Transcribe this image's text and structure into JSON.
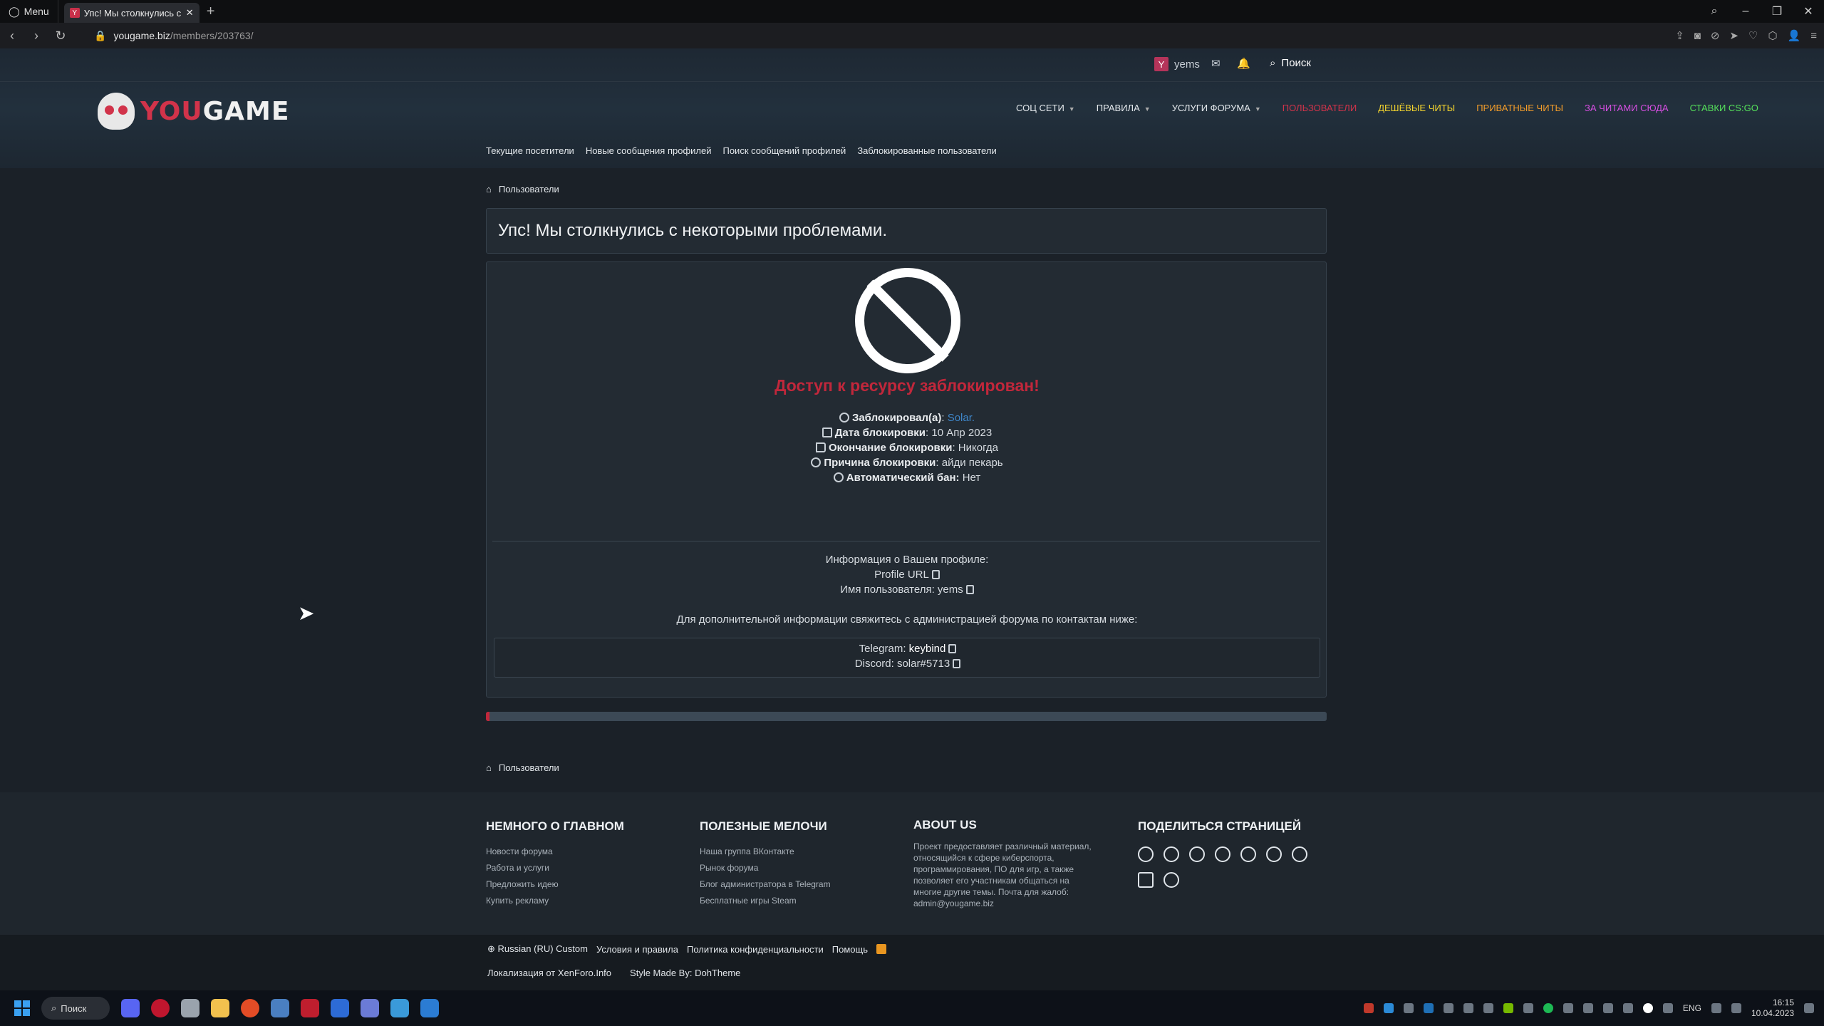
{
  "browser": {
    "menu_label": "Menu",
    "tab_title": "Упс! Мы столкнулись с не",
    "url_domain": "yougame.biz",
    "url_path": "/members/203763/"
  },
  "userbar": {
    "username": "yems",
    "avatar_letter": "Y",
    "search_label": "Поиск"
  },
  "logo": {
    "part1": "YOU",
    "part2": "GAME"
  },
  "nav": [
    {
      "label": "СОЦ СЕТИ",
      "color": "#e4e8ec",
      "dropdown": true
    },
    {
      "label": "ПРАВИЛА",
      "color": "#e4e8ec",
      "dropdown": true
    },
    {
      "label": "УСЛУГИ ФОРУМА",
      "color": "#e4e8ec",
      "dropdown": true
    },
    {
      "label": "ПОЛЬЗОВАТЕЛИ",
      "color": "#d1334a",
      "dropdown": false
    },
    {
      "label": "ДЕШЁВЫЕ ЧИТЫ",
      "color": "#f2d22e",
      "dropdown": false
    },
    {
      "label": "ПРИВАТНЫЕ ЧИТЫ",
      "color": "#f39c2a",
      "dropdown": false
    },
    {
      "label": "ЗА ЧИТАМИ СЮДА",
      "color": "#d54ee0",
      "dropdown": false
    },
    {
      "label": "СТАВКИ CS:GO",
      "color": "#55e05a",
      "dropdown": false
    }
  ],
  "subnav": [
    "Текущие посетители",
    "Новые сообщения профилей",
    "Поиск сообщений профилей",
    "Заблокированные пользователи"
  ],
  "breadcrumb": "Пользователи",
  "page_title": "Упс! Мы столкнулись с некоторыми проблемами.",
  "block": {
    "title": "Доступ к ресурсу заблокирован!",
    "blocked_by_label": "Заблокировал(а)",
    "blocked_by_value": "Solar.",
    "date_label": "Дата блокировки",
    "date_value": "10 Апр 2023",
    "end_label": "Окончание блокировки",
    "end_value": "Никогда",
    "reason_label": "Причина блокировки",
    "reason_value": "айди пекарь",
    "auto_label": "Автоматический бан:",
    "auto_value": "Нет",
    "profile_info": "Информация о Вашем профиле:",
    "profile_url": "Profile URL",
    "username_line": "Имя пользователя: yems",
    "contact_note": "Для дополнительной информации свяжитесь с администрацией форума по контактам ниже:",
    "telegram_label": "Telegram:",
    "telegram_value": "keybind",
    "discord_label": "Discord:",
    "discord_value": "solar#5713"
  },
  "footer": {
    "col1": {
      "title": "НЕМНОГО О ГЛАВНОМ",
      "items": [
        "Новости форума",
        "Работа и услуги",
        "Предложить идею",
        "Купить рекламу"
      ]
    },
    "col2": {
      "title": "ПОЛЕЗНЫЕ МЕЛОЧИ",
      "items": [
        "Наша группа ВКонтакте",
        "Рынок форума",
        "Блог администратора в Telegram",
        "Бесплатные игры Steam"
      ]
    },
    "col3": {
      "title": "ABOUT US",
      "text": "Проект предоставляет различный материал, относящийся к сфере киберспорта, программирования, ПО для игр, а также позволяет его участникам общаться на многие другие темы. Почта для жалоб: admin@yougame.biz"
    },
    "col4": {
      "title": "ПОДЕЛИТЬСЯ СТРАНИЦЕЙ"
    }
  },
  "copyright": {
    "lang": "Russian (RU) Custom",
    "terms": "Условия и правила",
    "privacy": "Политика конфиденциальности",
    "help": "Помощь",
    "localization": "Локализация от XenForo.Info",
    "style": "Style Made By: DohTheme"
  },
  "taskbar": {
    "search": "Поиск",
    "lang": "ENG",
    "time": "16:15",
    "date": "10.04.2023"
  }
}
